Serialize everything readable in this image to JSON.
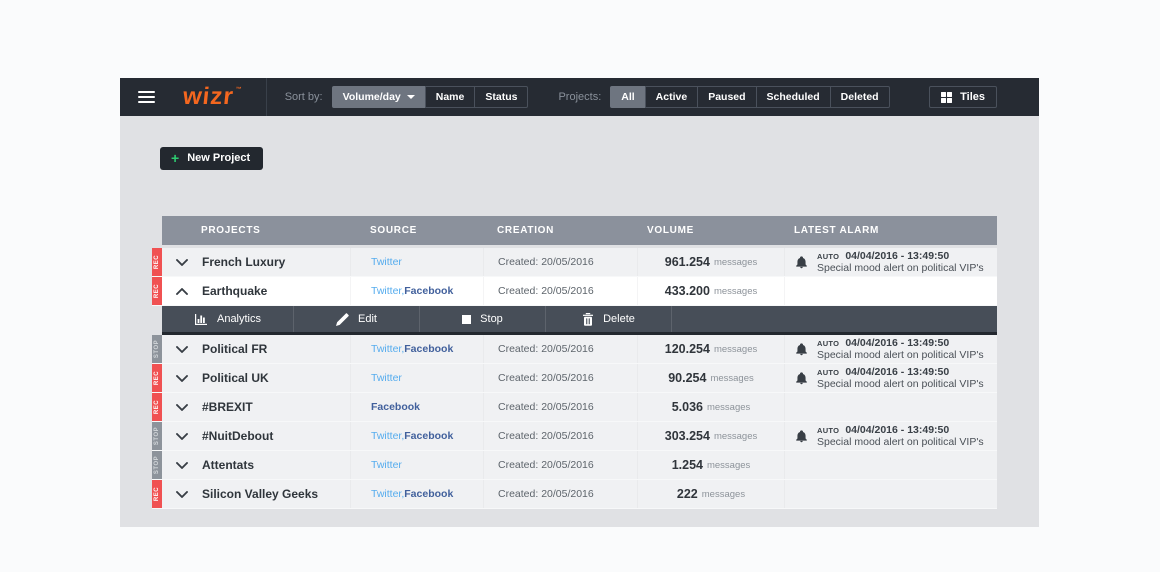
{
  "navbar": {
    "logo": "wizr",
    "logo_tm": "™",
    "sort_label": "Sort by:",
    "sort_options": [
      {
        "label": "Volume/day",
        "active": true,
        "has_caret": true
      },
      {
        "label": "Name",
        "active": false
      },
      {
        "label": "Status",
        "active": false
      }
    ],
    "projects_label": "Projects:",
    "project_filters": [
      {
        "label": "All",
        "active": true
      },
      {
        "label": "Active",
        "active": false
      },
      {
        "label": "Paused",
        "active": false
      },
      {
        "label": "Scheduled",
        "active": false
      },
      {
        "label": "Deleted",
        "active": false
      }
    ],
    "tiles_label": "Tiles"
  },
  "new_project_label": "New Project",
  "table": {
    "headers": [
      "PROJECTS",
      "SOURCE",
      "CREATION",
      "VOLUME",
      "LATEST ALARM"
    ],
    "volume_unit": "messages",
    "rows": [
      {
        "status": "REC",
        "name": "French Luxury",
        "expanded": false,
        "sources": [
          "Twitter"
        ],
        "creation": "Created: 20/05/2016",
        "volume": "961.254",
        "alarm": {
          "tag": "AUTO",
          "datetime": "04/04/2016 - 13:49:50",
          "description": "Special mood alert on political VIP's"
        }
      },
      {
        "status": "REC",
        "name": "Earthquake",
        "expanded": true,
        "sources": [
          "Twitter",
          "Facebook"
        ],
        "creation": "Created: 20/05/2016",
        "volume": "433.200",
        "alarm": null
      },
      {
        "status": "STOP",
        "name": "Political FR",
        "expanded": false,
        "sources": [
          "Twitter",
          "Facebook"
        ],
        "creation": "Created: 20/05/2016",
        "volume": "120.254",
        "alarm": {
          "tag": "AUTO",
          "datetime": "04/04/2016 - 13:49:50",
          "description": "Special mood alert on political VIP's"
        }
      },
      {
        "status": "REC",
        "name": "Political UK",
        "expanded": false,
        "sources": [
          "Twitter"
        ],
        "creation": "Created: 20/05/2016",
        "volume": "90.254",
        "alarm": {
          "tag": "AUTO",
          "datetime": "04/04/2016 - 13:49:50",
          "description": "Special mood alert on political VIP's"
        }
      },
      {
        "status": "REC",
        "name": "#BREXIT",
        "expanded": false,
        "sources": [
          "Facebook"
        ],
        "creation": "Created: 20/05/2016",
        "volume": "5.036",
        "alarm": null
      },
      {
        "status": "STOP",
        "name": "#NuitDebout",
        "expanded": false,
        "sources": [
          "Twitter",
          "Facebook"
        ],
        "creation": "Created: 20/05/2016",
        "volume": "303.254",
        "alarm": {
          "tag": "AUTO",
          "datetime": "04/04/2016 - 13:49:50",
          "description": "Special mood alert on political VIP's"
        }
      },
      {
        "status": "STOP",
        "name": "Attentats",
        "expanded": false,
        "sources": [
          "Twitter"
        ],
        "creation": "Created: 20/05/2016",
        "volume": "1.254",
        "alarm": null
      },
      {
        "status": "REC",
        "name": "Silicon Valley Geeks",
        "expanded": false,
        "sources": [
          "Twitter",
          "Facebook"
        ],
        "creation": "Created: 20/05/2016",
        "volume": "222",
        "alarm": null
      }
    ],
    "row_actions": [
      {
        "icon": "analytics-icon",
        "label": "Analytics"
      },
      {
        "icon": "edit-icon",
        "label": "Edit"
      },
      {
        "icon": "stop-icon",
        "label": "Stop"
      },
      {
        "icon": "delete-icon",
        "label": "Delete"
      }
    ]
  },
  "colors": {
    "brand_orange": "#f4671f",
    "navbar_bg": "#262b33",
    "rec_red": "#f05152",
    "stop_gray": "#8d939b",
    "twitter_blue": "#55acee",
    "facebook_blue": "#41609c",
    "header_gray": "#8b919c",
    "toolbar_gray": "#474e58",
    "plus_green": "#2ecc71"
  }
}
